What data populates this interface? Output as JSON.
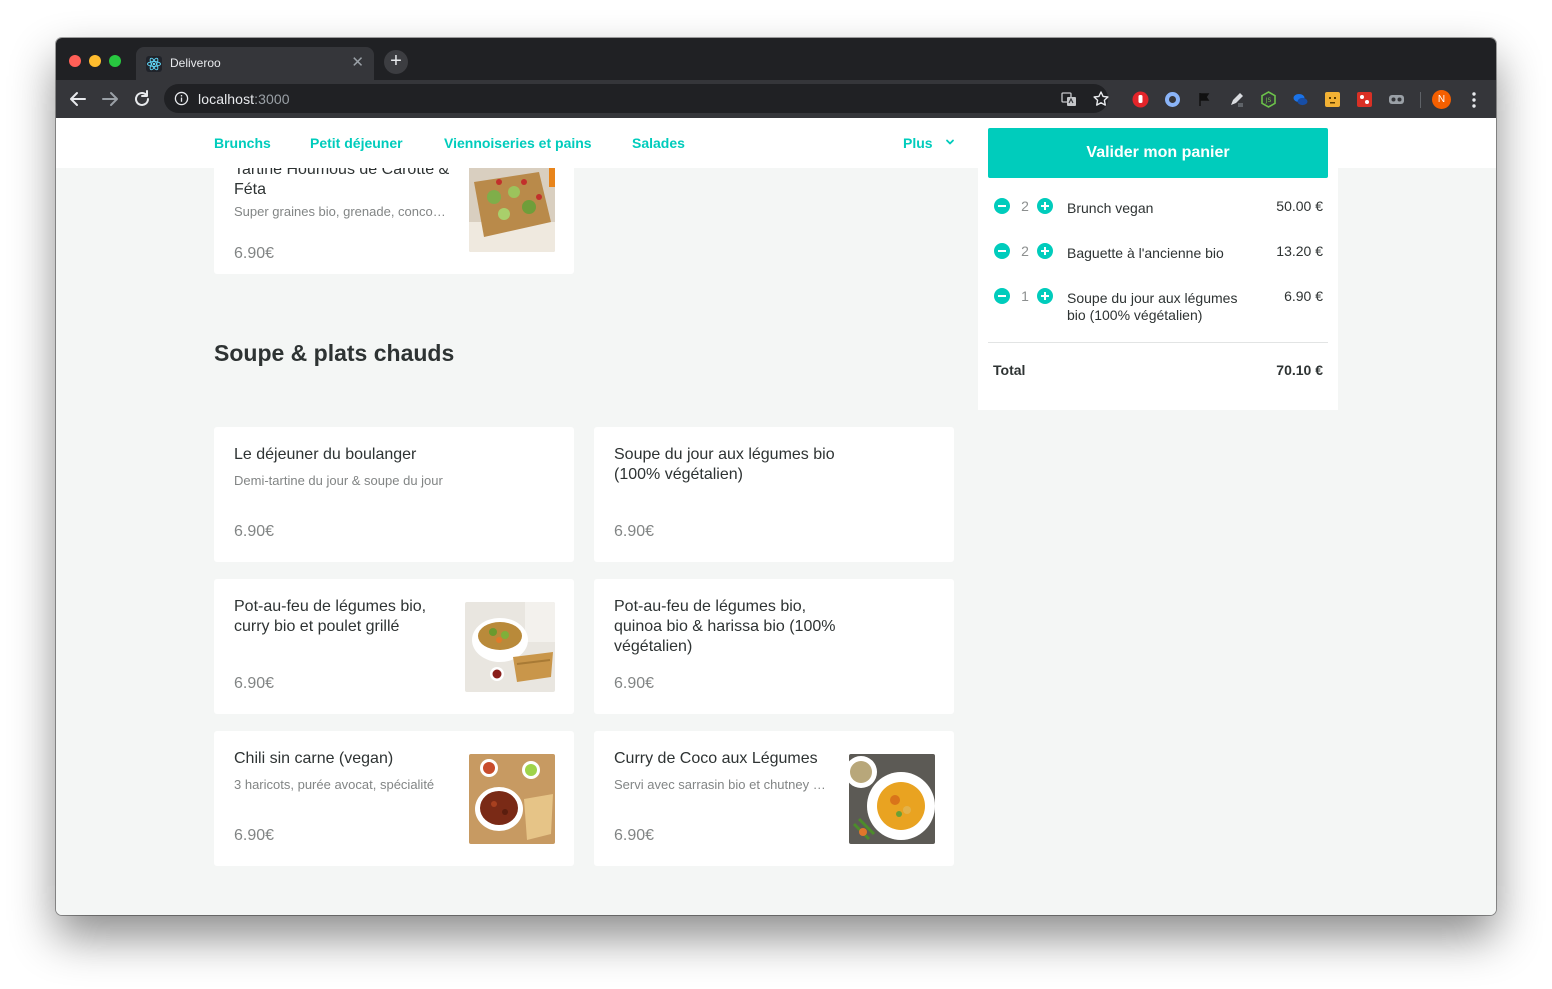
{
  "browser": {
    "tab_title": "Deliveroo",
    "url_host": "localhost",
    "url_port": ":3000",
    "profile_initial": "N",
    "tab_close_glyph": "✕",
    "new_tab_glyph": "+"
  },
  "nav": {
    "categories": [
      "Brunchs",
      "Petit déjeuner",
      "Viennoiseries et pains",
      "Salades"
    ],
    "more_label": "Plus"
  },
  "partial_card": {
    "title": "Tartine Houmous de Carotte & Féta",
    "description": "Super graines bio, grenade, concombre",
    "price": "6.90€"
  },
  "section": {
    "title": "Soupe & plats chauds",
    "items": [
      {
        "title": "Le déjeuner du boulanger",
        "description": "Demi-tartine du jour & soupe du jour",
        "price": "6.90€",
        "has_image": false
      },
      {
        "title": "Soupe du jour aux légumes bio (100% végétalien)",
        "description": "",
        "price": "6.90€",
        "has_image": false
      },
      {
        "title": "Pot-au-feu de légumes bio, curry bio et poulet grillé",
        "description": "",
        "price": "6.90€",
        "has_image": true
      },
      {
        "title": "Pot-au-feu de légumes bio, quinoa bio & harissa bio (100% végétalien)",
        "description": "",
        "price": "6.90€",
        "has_image": false
      },
      {
        "title": "Chili sin carne (vegan)",
        "description": "3 haricots, purée avocat, spécialité",
        "price": "6.90€",
        "has_image": true
      },
      {
        "title": "Curry de Coco aux Légumes",
        "description": "Servi avec sarrasin bio et chutney maison",
        "price": "6.90€",
        "has_image": true
      }
    ]
  },
  "basket": {
    "checkout_label": "Valider mon panier",
    "items": [
      {
        "qty": "2",
        "name": "Brunch vegan",
        "price": "50.00 €"
      },
      {
        "qty": "2",
        "name": "Baguette à l'ancienne bio",
        "price": "13.20 €"
      },
      {
        "qty": "1",
        "name": "Soupe du jour aux légumes bio (100% végétalien)",
        "price": "6.90 €"
      }
    ],
    "total_label": "Total",
    "total_value": "70.10 €"
  },
  "colors": {
    "accent": "#00ccbc",
    "text": "#2e3333",
    "muted": "#828585",
    "background": "#f4f6f5"
  }
}
